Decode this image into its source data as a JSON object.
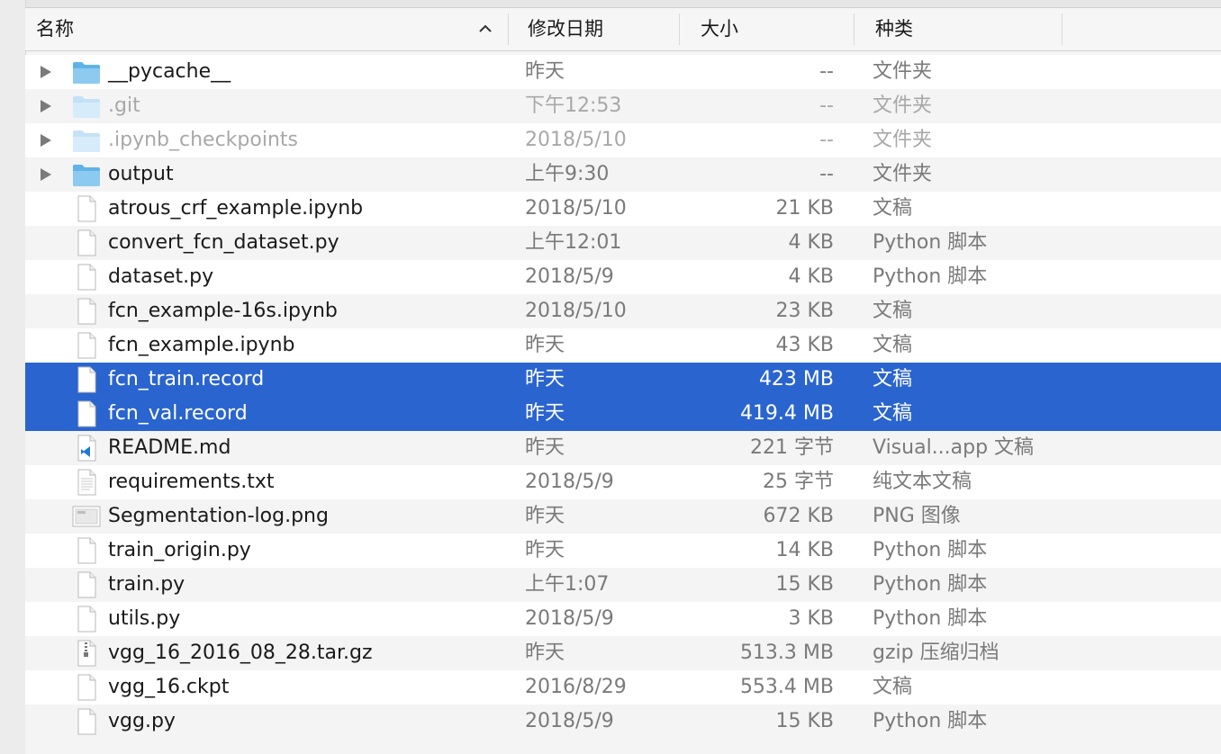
{
  "columns": {
    "name": "名称",
    "date": "修改日期",
    "size": "大小",
    "kind": "种类"
  },
  "files": [
    {
      "name": "__pycache__",
      "date": "昨天",
      "size": "--",
      "kind": "文件夹",
      "icon": "folder-icon",
      "folder": true,
      "dim": false,
      "selected": false
    },
    {
      "name": ".git",
      "date": "下午12:53",
      "size": "--",
      "kind": "文件夹",
      "icon": "folder-icon",
      "folder": true,
      "dim": true,
      "selected": false
    },
    {
      "name": ".ipynb_checkpoints",
      "date": "2018/5/10",
      "size": "--",
      "kind": "文件夹",
      "icon": "folder-icon",
      "folder": true,
      "dim": true,
      "selected": false
    },
    {
      "name": "output",
      "date": "上午9:30",
      "size": "--",
      "kind": "文件夹",
      "icon": "folder-icon",
      "folder": true,
      "dim": false,
      "selected": false
    },
    {
      "name": "atrous_crf_example.ipynb",
      "date": "2018/5/10",
      "size": "21 KB",
      "kind": "文稿",
      "icon": "document-icon",
      "folder": false,
      "dim": false,
      "selected": false
    },
    {
      "name": "convert_fcn_dataset.py",
      "date": "上午12:01",
      "size": "4 KB",
      "kind": "Python 脚本",
      "icon": "document-icon",
      "folder": false,
      "dim": false,
      "selected": false
    },
    {
      "name": "dataset.py",
      "date": "2018/5/9",
      "size": "4 KB",
      "kind": "Python 脚本",
      "icon": "document-icon",
      "folder": false,
      "dim": false,
      "selected": false
    },
    {
      "name": "fcn_example-16s.ipynb",
      "date": "2018/5/10",
      "size": "23 KB",
      "kind": "文稿",
      "icon": "document-icon",
      "folder": false,
      "dim": false,
      "selected": false
    },
    {
      "name": "fcn_example.ipynb",
      "date": "昨天",
      "size": "43 KB",
      "kind": "文稿",
      "icon": "document-icon",
      "folder": false,
      "dim": false,
      "selected": false
    },
    {
      "name": "fcn_train.record",
      "date": "昨天",
      "size": "423 MB",
      "kind": "文稿",
      "icon": "document-icon",
      "folder": false,
      "dim": false,
      "selected": true
    },
    {
      "name": "fcn_val.record",
      "date": "昨天",
      "size": "419.4 MB",
      "kind": "文稿",
      "icon": "document-icon",
      "folder": false,
      "dim": false,
      "selected": true
    },
    {
      "name": "README.md",
      "date": "昨天",
      "size": "221 字节",
      "kind": "Visual...app 文稿",
      "icon": "vscode-document-icon",
      "folder": false,
      "dim": false,
      "selected": false
    },
    {
      "name": "requirements.txt",
      "date": "2018/5/9",
      "size": "25 字节",
      "kind": "纯文本文稿",
      "icon": "text-document-icon",
      "folder": false,
      "dim": false,
      "selected": false
    },
    {
      "name": "Segmentation-log.png",
      "date": "昨天",
      "size": "672 KB",
      "kind": "PNG 图像",
      "icon": "image-icon",
      "folder": false,
      "dim": false,
      "selected": false
    },
    {
      "name": "train_origin.py",
      "date": "昨天",
      "size": "14 KB",
      "kind": "Python 脚本",
      "icon": "document-icon",
      "folder": false,
      "dim": false,
      "selected": false
    },
    {
      "name": "train.py",
      "date": "上午1:07",
      "size": "15 KB",
      "kind": "Python 脚本",
      "icon": "document-icon",
      "folder": false,
      "dim": false,
      "selected": false
    },
    {
      "name": "utils.py",
      "date": "2018/5/9",
      "size": "3 KB",
      "kind": "Python 脚本",
      "icon": "document-icon",
      "folder": false,
      "dim": false,
      "selected": false
    },
    {
      "name": "vgg_16_2016_08_28.tar.gz",
      "date": "昨天",
      "size": "513.3 MB",
      "kind": "gzip 压缩归档",
      "icon": "archive-icon",
      "folder": false,
      "dim": false,
      "selected": false
    },
    {
      "name": "vgg_16.ckpt",
      "date": "2016/8/29",
      "size": "553.4 MB",
      "kind": "文稿",
      "icon": "document-icon",
      "folder": false,
      "dim": false,
      "selected": false
    },
    {
      "name": "vgg.py",
      "date": "2018/5/9",
      "size": "15 KB",
      "kind": "Python 脚本",
      "icon": "document-icon",
      "folder": false,
      "dim": false,
      "selected": false
    }
  ],
  "colors": {
    "selection": "#2a64cf",
    "folder": "#5fb3e8",
    "text": "#1a1a1a",
    "secondary_text": "#7a7a7a"
  }
}
